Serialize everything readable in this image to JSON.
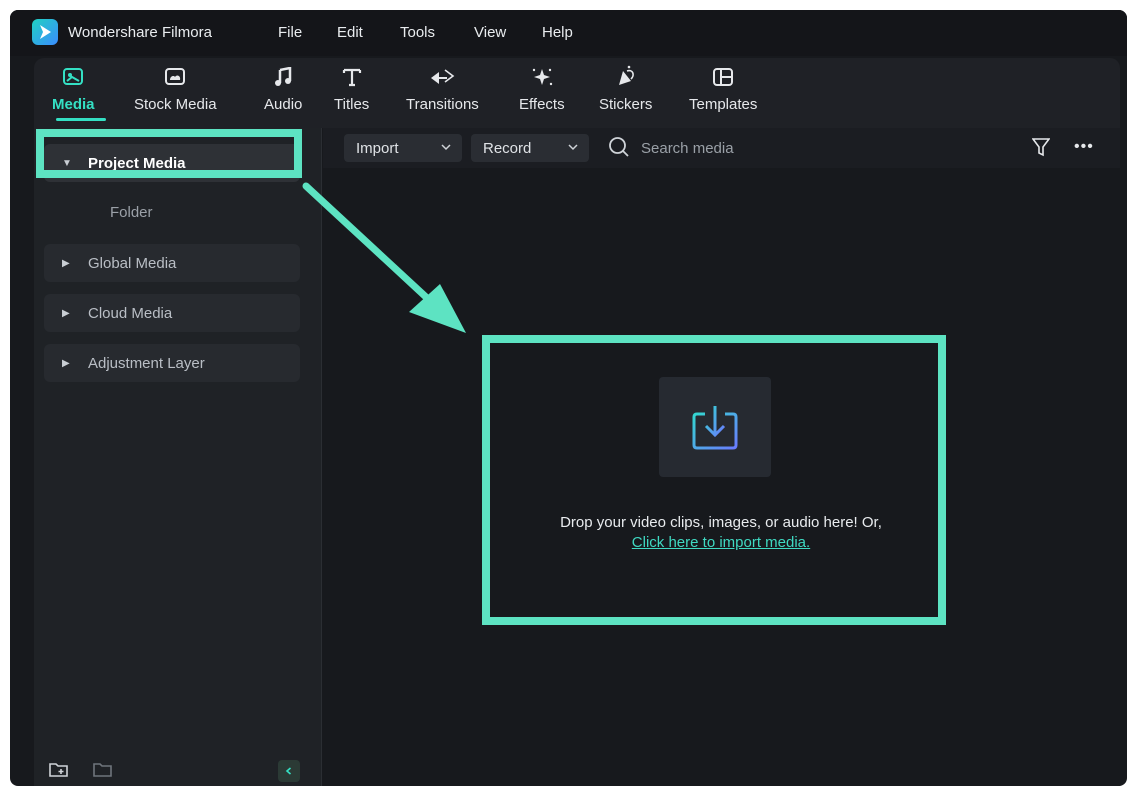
{
  "app": {
    "name": "Wondershare Filmora"
  },
  "menu": [
    "File",
    "Edit",
    "Tools",
    "View",
    "Help"
  ],
  "tabs": [
    {
      "label": "Media",
      "icon": "media-icon",
      "active": true
    },
    {
      "label": "Stock Media",
      "icon": "stock-media-icon"
    },
    {
      "label": "Audio",
      "icon": "music-note-icon"
    },
    {
      "label": "Titles",
      "icon": "text-t-icon"
    },
    {
      "label": "Transitions",
      "icon": "transition-arrows-icon"
    },
    {
      "label": "Effects",
      "icon": "sparkle-icon"
    },
    {
      "label": "Stickers",
      "icon": "sticker-icon"
    },
    {
      "label": "Templates",
      "icon": "template-icon"
    }
  ],
  "sidebar": {
    "project_media": "Project Media",
    "folder": "Folder",
    "global_media": "Global Media",
    "cloud_media": "Cloud Media",
    "adjustment_layer": "Adjustment Layer"
  },
  "toolbar": {
    "import_label": "Import",
    "record_label": "Record",
    "search_placeholder": "Search media"
  },
  "dropzone": {
    "text": "Drop your video clips, images, or audio here! Or,",
    "link": "Click here to import media."
  },
  "colors": {
    "accent": "#34e0c4",
    "highlight": "#5de3c2",
    "background": "#17191d"
  }
}
